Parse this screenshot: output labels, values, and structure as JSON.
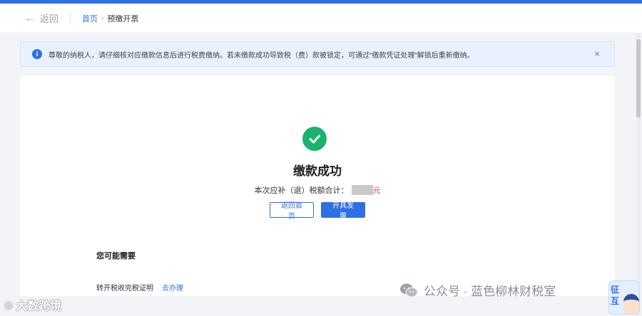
{
  "header": {
    "back_label": "返回",
    "breadcrumb": {
      "home": "首页",
      "separator": "›",
      "current": "预缴开票"
    }
  },
  "notice": {
    "text": "尊敬的纳税人，请仔细核对应缴款信息后进行税费缴纳。若未缴款成功导致税（费）款被锁定，可通过“缴款凭证处理”解锁后重新缴纳。",
    "close": "×",
    "icon": "info-icon"
  },
  "result": {
    "title": "缴款成功",
    "amount_label": "本次应补（退）税额合计：",
    "amount_unit": "元",
    "icon": "check-circle-icon",
    "status_color": "#19b36b"
  },
  "buttons": {
    "back_home": "返回首页",
    "issue_invoice": "开具发票"
  },
  "needs": {
    "title": "您可能需要",
    "items": [
      {
        "label": "转开税收完税证明",
        "action": "去办理"
      }
    ]
  },
  "watermarks": {
    "left": "大数跨境",
    "right": "公众号 · 蓝色柳林财税室"
  },
  "assistant": {
    "label": "征\n互"
  },
  "colors": {
    "accent": "#2f6fe4",
    "success": "#19b36b",
    "amount_unit": "#e8413a"
  }
}
